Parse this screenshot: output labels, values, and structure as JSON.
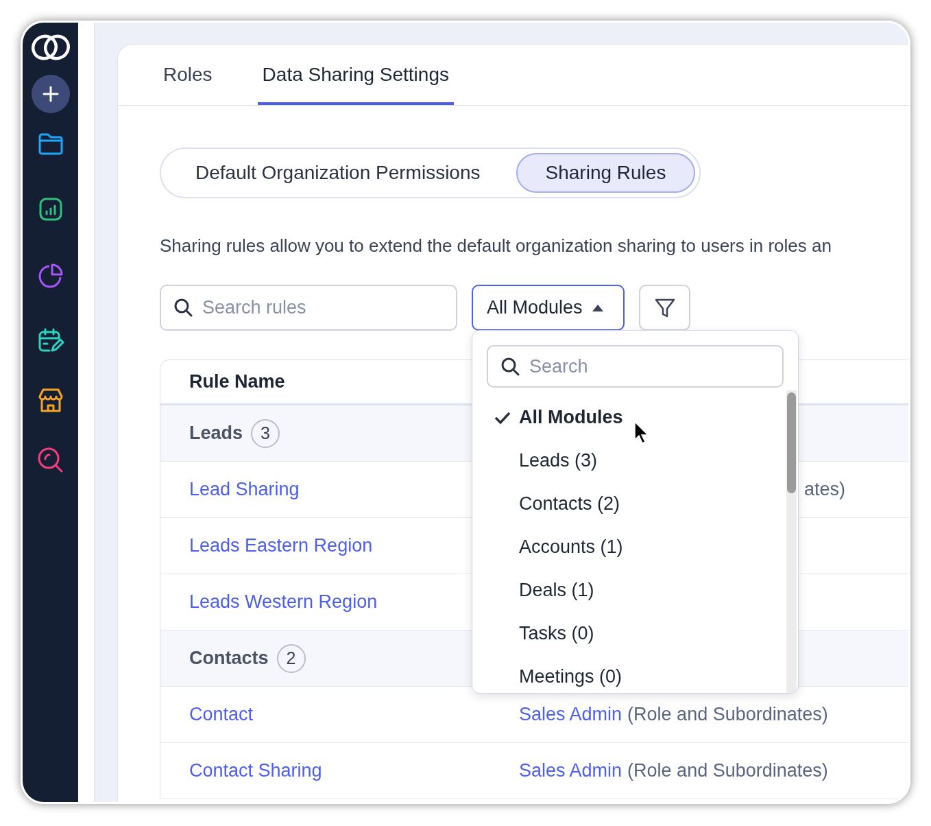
{
  "tabs": [
    {
      "label": "Roles",
      "selected": false
    },
    {
      "label": "Data Sharing Settings",
      "selected": true
    }
  ],
  "segments": [
    {
      "label": "Default Organization Permissions",
      "selected": false
    },
    {
      "label": "Sharing Rules",
      "selected": true
    }
  ],
  "description": "Sharing rules allow you to extend the default organization sharing to users in roles an",
  "search": {
    "placeholder": "Search rules"
  },
  "module_select": {
    "value": "All Modules",
    "expanded": true
  },
  "dropdown": {
    "search_placeholder": "Search",
    "options": [
      {
        "label": "All Modules",
        "selected": true
      },
      {
        "label": "Leads (3)",
        "selected": false
      },
      {
        "label": "Contacts (2)",
        "selected": false
      },
      {
        "label": "Accounts (1)",
        "selected": false
      },
      {
        "label": "Deals (1)",
        "selected": false
      },
      {
        "label": "Tasks (0)",
        "selected": false
      },
      {
        "label": "Meetings (0)",
        "selected": false
      }
    ]
  },
  "table": {
    "columns": [
      "Rule Name"
    ],
    "rows": [
      {
        "kind": "group",
        "label": "Leads",
        "count": "3"
      },
      {
        "kind": "rule",
        "name": "Lead Sharing",
        "shared_with": {
          "note": "ates)"
        }
      },
      {
        "kind": "rule",
        "name": "Leads Eastern Region"
      },
      {
        "kind": "rule",
        "name": "Leads Western Region"
      },
      {
        "kind": "group",
        "label": "Contacts",
        "count": "2"
      },
      {
        "kind": "rule",
        "name": "Contact",
        "shared_with": {
          "link": "Sales Admin",
          "note": "(Role and Subordinates)"
        }
      },
      {
        "kind": "rule",
        "name": "Contact Sharing",
        "shared_with": {
          "link": "Sales Admin",
          "note": "(Role and Subordinates)"
        }
      }
    ]
  }
}
